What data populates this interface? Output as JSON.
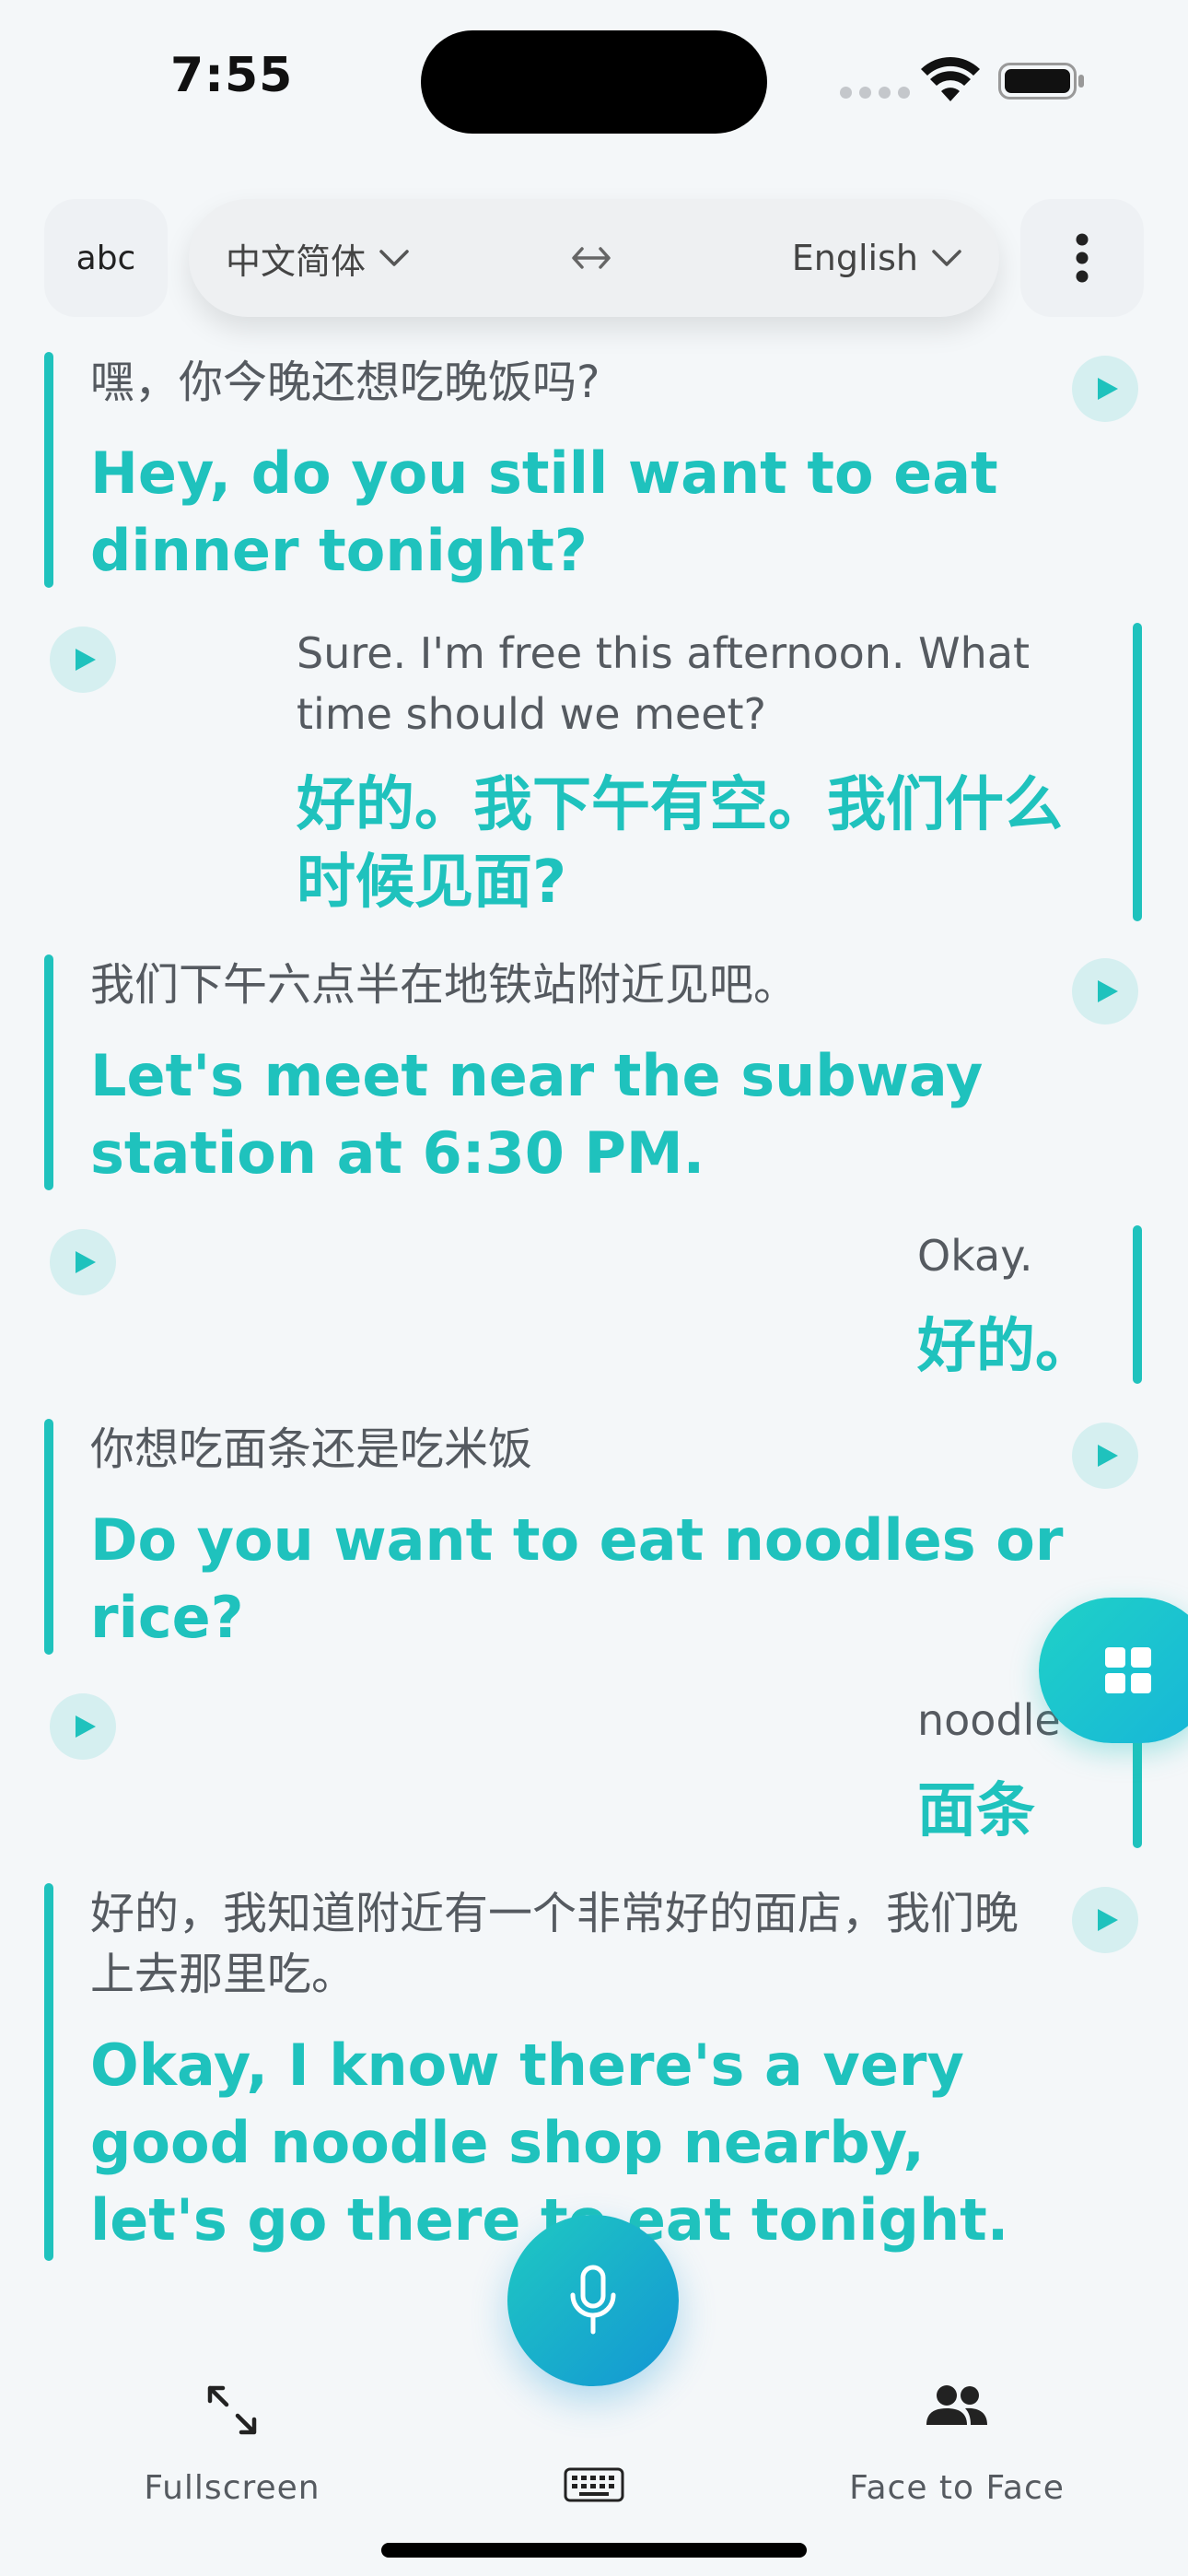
{
  "status": {
    "time": "7:55"
  },
  "toolbar": {
    "abc_label": "abc",
    "source_lang": "中文简体",
    "target_lang": "English"
  },
  "messages": [
    {
      "side": "left",
      "original": "嘿，你今晚还想吃晚饭吗?",
      "translation": "Hey, do you still want to eat dinner tonight?"
    },
    {
      "side": "right",
      "original": "Sure. I'm free this afternoon. What time should we meet?",
      "translation": "好的。我下午有空。我们什么时候见面?"
    },
    {
      "side": "left",
      "original": "我们下午六点半在地铁站附近见吧。",
      "translation": "Let's meet near the subway station at 6:30 PM."
    },
    {
      "side": "right",
      "original": "Okay.",
      "translation": "好的。"
    },
    {
      "side": "left",
      "original": "你想吃面条还是吃米饭",
      "translation": "Do you want to eat noodles or rice?"
    },
    {
      "side": "right",
      "original": "noodle",
      "translation": "面条"
    },
    {
      "side": "left",
      "original": "好的，我知道附近有一个非常好的面店，我们晚上去那里吃。",
      "translation": "Okay, I know there's a very good noodle shop nearby, let's go there to eat tonight."
    }
  ],
  "bottom_nav": {
    "fullscreen_label": "Fullscreen",
    "face_to_face_label": "Face to Face"
  },
  "colors": {
    "accent": "#1fc2bd",
    "background": "#f4f7f9",
    "play_bg": "#d5eff0"
  },
  "icons": {
    "play": "play-icon",
    "mic": "microphone-icon",
    "grid": "grid-icon",
    "fullscreen": "expand-arrows-icon",
    "face_to_face": "people-icon",
    "keyboard": "keyboard-icon",
    "swap": "swap-arrows-icon",
    "more": "more-vertical-icon"
  }
}
